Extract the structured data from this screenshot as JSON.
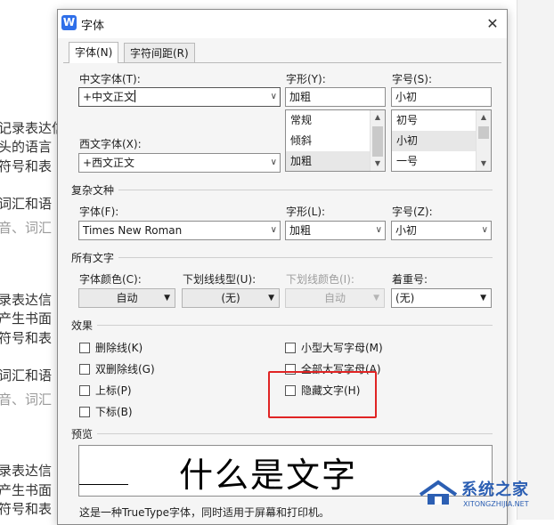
{
  "background": {
    "lines": [
      {
        "text": "记录表达信",
        "light": false
      },
      {
        "text": "头的语言",
        "light": false
      },
      {
        "text": "符号和表",
        "light": false
      },
      {
        "text": "词汇和语",
        "light": false
      },
      {
        "text": "音、词汇",
        "light": true
      },
      {
        "text": "录表达信",
        "light": false
      },
      {
        "text": "产生书面",
        "light": false
      },
      {
        "text": "符号和表",
        "light": false
      },
      {
        "text": "词汇和语",
        "light": false
      },
      {
        "text": "音、词汇",
        "light": true
      },
      {
        "text": "录表达信",
        "light": false
      },
      {
        "text": "产生书面",
        "light": false
      },
      {
        "text": "符号和表",
        "light": false
      }
    ]
  },
  "dialog": {
    "app_icon": "W",
    "title": "字体",
    "close": "✕",
    "tabs": [
      "字体(N)",
      "字符间距(R)"
    ],
    "chinese_font": {
      "label": "中文字体(T):",
      "value": "+中文正文"
    },
    "western_font": {
      "label": "西文字体(X):",
      "value": "+西文正文"
    },
    "style": {
      "label": "字形(Y):",
      "value": "加粗",
      "options": [
        "常规",
        "倾斜",
        "加粗"
      ],
      "selected": 2
    },
    "size": {
      "label": "字号(S):",
      "value": "小初",
      "options": [
        "初号",
        "小初",
        "一号"
      ],
      "selected": 1
    },
    "complex": {
      "section": "复杂文种",
      "font_label": "字体(F):",
      "font_value": "Times New Roman",
      "style_label": "字形(L):",
      "style_value": "加粗",
      "size_label": "字号(Z):",
      "size_value": "小初"
    },
    "all_text": {
      "section": "所有文字",
      "color_label": "字体颜色(C):",
      "color_value": "自动",
      "underline_label": "下划线线型(U):",
      "underline_value": "(无)",
      "underline_color_label": "下划线颜色(I):",
      "underline_color_value": "自动",
      "emphasis_label": "着重号:",
      "emphasis_value": "(无)"
    },
    "effects": {
      "section": "效果",
      "left": [
        "删除线(K)",
        "双删除线(G)",
        "上标(P)",
        "下标(B)"
      ],
      "right": [
        "小型大写字母(M)",
        "全部大写字母(A)",
        "隐藏文字(H)"
      ]
    },
    "preview": {
      "section": "预览",
      "sample": "什么是文字"
    },
    "note": "这是一种TrueType字体，同时适用于屏幕和打印机。"
  },
  "watermark": {
    "title": "系统之家",
    "subtitle": "XITONGZHIJIA.NET"
  },
  "colors": {
    "highlight_box": "#e02424",
    "accent": "#2f6fe9",
    "watermark": "#2c5fb3"
  }
}
